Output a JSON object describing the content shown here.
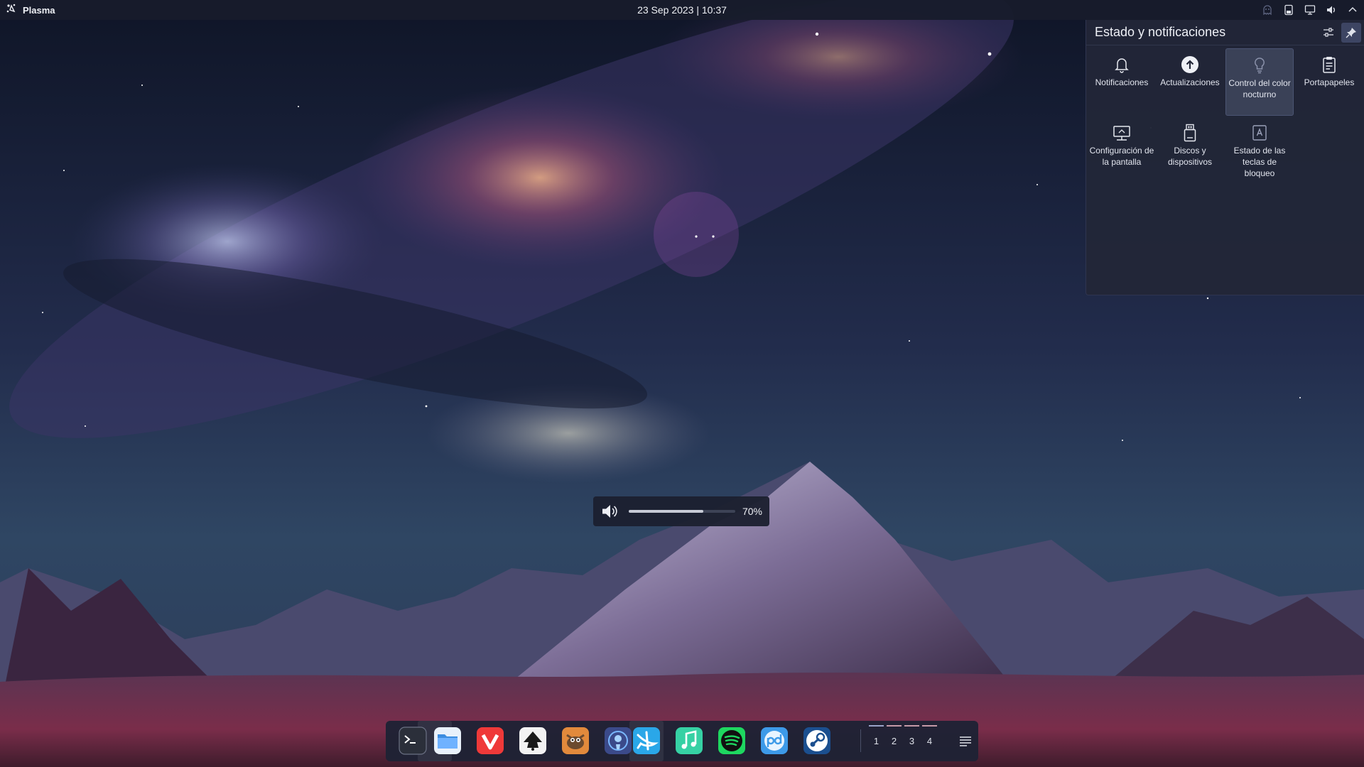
{
  "top_panel": {
    "launcher_label": "Plasma",
    "clock": "23 Sep 2023 | 10:37",
    "tray_icons": [
      "ghost-icon",
      "battery-device-icon",
      "display-icon",
      "volume-icon",
      "chevron-up-icon"
    ]
  },
  "popup": {
    "title": "Estado y notificaciones",
    "tiles": [
      {
        "label": "Notificaciones",
        "icon": "bell-icon"
      },
      {
        "label": "Actualizaciones",
        "icon": "update-icon"
      },
      {
        "label": "Control del color nocturno",
        "icon": "lightbulb-icon",
        "selected": true
      },
      {
        "label": "Portapapeles",
        "icon": "clipboard-icon"
      },
      {
        "label": "Configuración de la pantalla",
        "icon": "monitor-icon"
      },
      {
        "label": "Discos y dispositivos",
        "icon": "usb-drive-icon"
      },
      {
        "label": "Estado de las teclas de bloqueo",
        "icon": "keyboard-lock-icon"
      }
    ]
  },
  "volume_osd": {
    "value_text": "70%",
    "level": 0.7
  },
  "dock": {
    "apps": [
      {
        "name": "terminal",
        "color": "#2b2f3a"
      },
      {
        "name": "files",
        "color": "#3d8de0"
      },
      {
        "name": "vivaldi",
        "color": "#ef3939"
      },
      {
        "name": "inkscape",
        "color": "#f2f2f2"
      },
      {
        "name": "gimp",
        "color": "#e28a3c"
      },
      {
        "name": "podcast",
        "color": "#3b4a8a"
      },
      {
        "name": "swift-app",
        "color": "#2aa7e8"
      },
      {
        "name": "music",
        "color": "#36d1a4"
      },
      {
        "name": "spotify",
        "color": "#1ed760"
      },
      {
        "name": "qbittorrent",
        "color": "#3d9ae8"
      },
      {
        "name": "steam",
        "color": "#1b4f8f"
      }
    ],
    "desktops": [
      "1",
      "2",
      "3",
      "4"
    ],
    "current_desktop": 0
  },
  "colors": {
    "panel": "#181c2c",
    "popup": "#222638",
    "accent": "#9aa3c8"
  }
}
